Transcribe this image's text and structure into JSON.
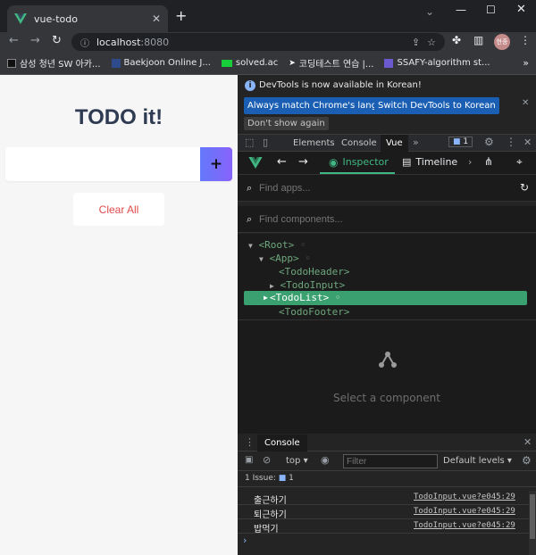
{
  "browser": {
    "tab_title": "vue-todo",
    "url_host": "localhost",
    "url_port": ":8080",
    "profile_initial": "현종",
    "bookmarks": [
      "삼성 청년 SW 아카...",
      "Baekjoon Online J...",
      "solved.ac",
      "코딩테스트 연습 |...",
      "SSAFY-algorithm st..."
    ]
  },
  "app": {
    "title": "TODO it!",
    "input_placeholder": "",
    "add_symbol": "+",
    "clear_label": "Clear All"
  },
  "devtools": {
    "notice": "DevTools is now available in Korean!",
    "btn_match": "Always match Chrome's language",
    "btn_switch": "Switch DevTools to Korean",
    "btn_dont_show": "Don't show again",
    "tabs": [
      "Elements",
      "Console",
      "Vue"
    ],
    "issue_badge": "1",
    "vue_tabs": {
      "inspector": "Inspector",
      "timeline": "Timeline"
    },
    "find_apps": "Find apps...",
    "find_components": "Find components...",
    "tree": [
      "<Root>",
      "<App>",
      "<TodoHeader>",
      "<TodoInput>",
      "<TodoList>",
      "<TodoFooter>"
    ],
    "select_component": "Select a component",
    "console": {
      "tab": "Console",
      "context": "top",
      "filter_placeholder": "Filter",
      "levels": "Default levels",
      "issues": "1 Issue:",
      "issues_count": "1",
      "logs": [
        {
          "text": "출근하기",
          "source": "TodoInput.vue?e045:29"
        },
        {
          "text": "퇴근하기",
          "source": "TodoInput.vue?e045:29"
        },
        {
          "text": "밥먹기",
          "source": "TodoInput.vue?e045:29"
        }
      ]
    }
  }
}
